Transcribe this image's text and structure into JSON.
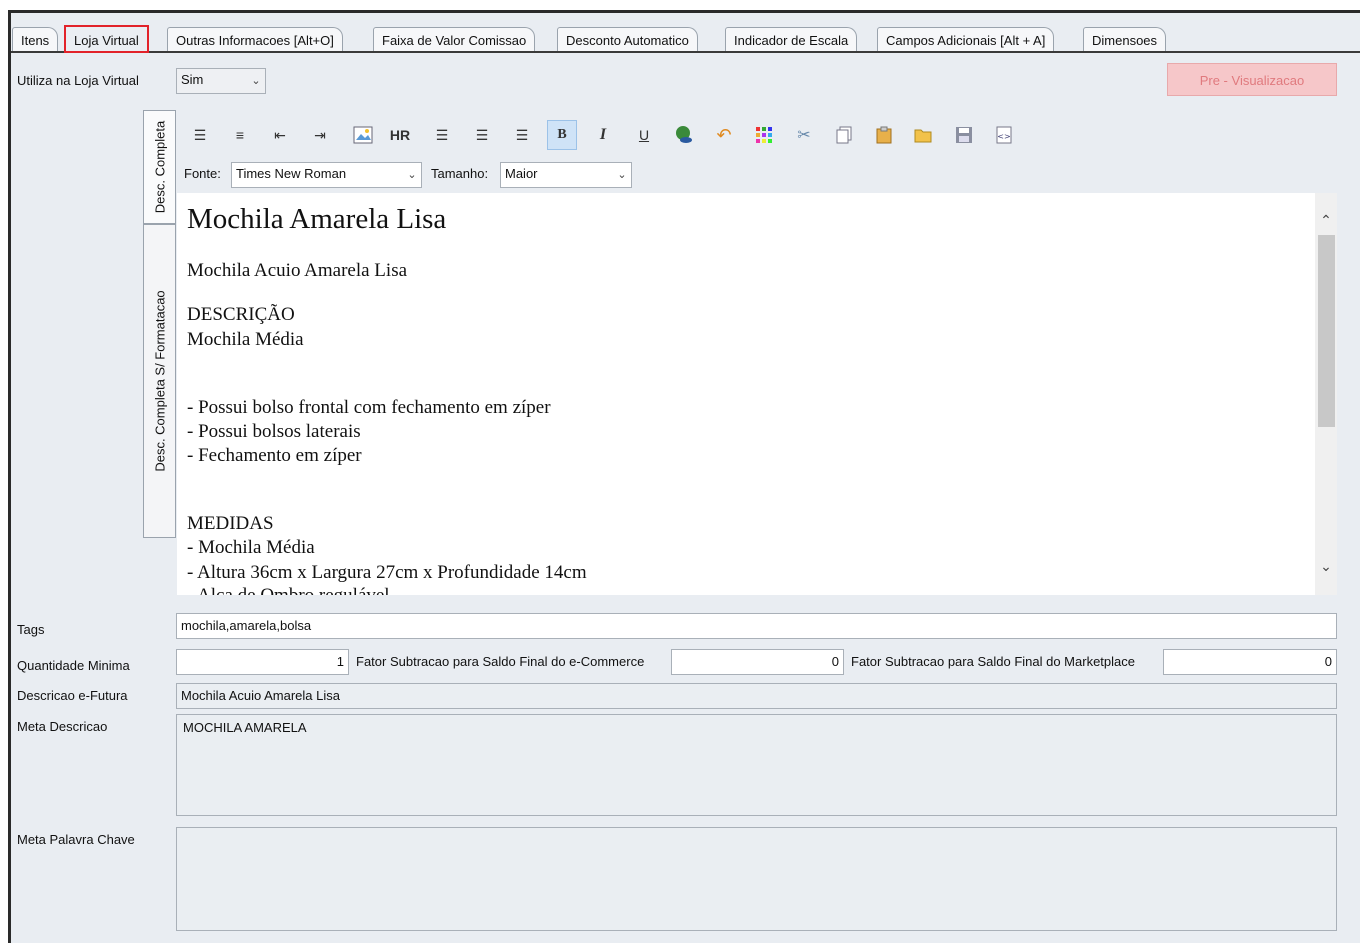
{
  "tabs": [
    {
      "label": "Itens",
      "active": false
    },
    {
      "label": "Loja Virtual",
      "active": true
    },
    {
      "label": "Outras Informacoes [Alt+O]",
      "active": false
    },
    {
      "label": "Faixa de Valor Comissao",
      "active": false
    },
    {
      "label": "Desconto Automatico",
      "active": false
    },
    {
      "label": "Indicador de Escala",
      "active": false
    },
    {
      "label": "Campos Adicionais [Alt + A]",
      "active": false
    },
    {
      "label": "Dimensoes",
      "active": false
    }
  ],
  "loja": {
    "label": "Utiliza na Loja Virtual",
    "value": "Sim"
  },
  "preview_button": "Pre - Visualizacao",
  "vtabs": [
    "Desc. Completa",
    "Desc. Completa S/ Formatacao"
  ],
  "toolbar": {
    "icons": [
      "numbered-list-icon",
      "bullet-list-icon",
      "outdent-icon",
      "indent-icon",
      "insert-image-icon",
      "horizontal-rule-icon",
      "align-left-icon",
      "align-center-icon",
      "align-right-icon",
      "bold-icon",
      "italic-icon",
      "underline-icon",
      "hyperlink-icon",
      "undo-icon",
      "color-palette-icon",
      "cut-icon",
      "copy-icon",
      "paste-icon",
      "open-file-icon",
      "save-icon",
      "source-code-icon"
    ],
    "hr_label": "HR",
    "bold_label": "B",
    "italic_label": "I",
    "underline_label": "U",
    "font_label": "Fonte:",
    "font_value": "Times New Roman",
    "size_label": "Tamanho:",
    "size_value": "Maior"
  },
  "editor": {
    "heading": "Mochila Amarela Lisa",
    "subtitle": "Mochila Acuio Amarela Lisa",
    "desc_title": "DESCRIÇÃO",
    "desc_line": "Mochila Média",
    "features": [
      "- Possui bolso frontal com fechamento em zíper",
      "- Possui bolsos laterais",
      "- Fechamento em zíper"
    ],
    "medidas_title": "MEDIDAS",
    "medidas": [
      "- Mochila Média",
      "- Altura 36cm x Largura 27cm x Profundidade 14cm",
      "- Alça de Ombro regulável"
    ]
  },
  "form": {
    "tags_label": "Tags",
    "tags_value": "mochila,amarela,bolsa",
    "qtd_label": "Quantidade Minima",
    "qtd_value": "1",
    "fator_ecom_label": "Fator Subtracao para Saldo Final do e-Commerce",
    "fator_ecom_value": "0",
    "fator_mkt_label": "Fator Subtracao para Saldo Final do Marketplace",
    "fator_mkt_value": "0",
    "desc_efutura_label": "Descricao e-Futura",
    "desc_efutura_value": "Mochila Acuio Amarela Lisa",
    "meta_desc_label": "Meta Descricao",
    "meta_desc_value": "MOCHILA AMARELA",
    "meta_kw_label": "Meta Palavra Chave",
    "meta_kw_value": ""
  }
}
